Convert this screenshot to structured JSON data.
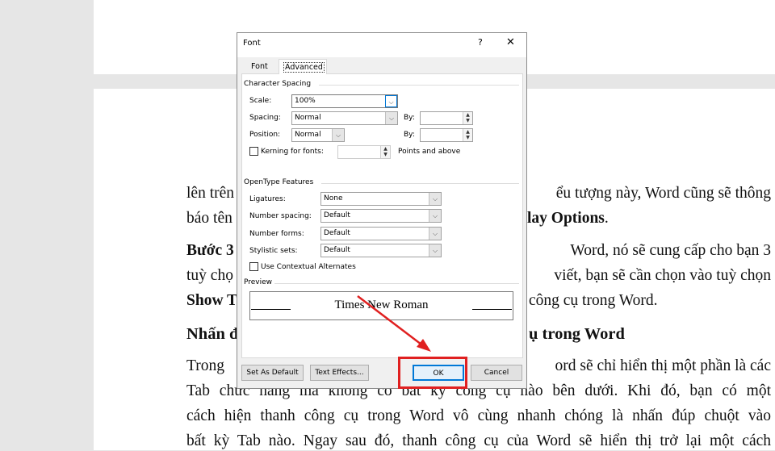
{
  "document": {
    "lines": [
      {
        "left": "lên trên",
        "right": "ểu tượng này, Word cũng sẽ thông"
      },
      {
        "left": "báo tên",
        "right_bold": "lay Options",
        "right": "."
      },
      {
        "left_bold": "Bước 3",
        "right": "Word, nó sẽ cung cấp cho bạn 3"
      },
      {
        "left": "tuỳ chọ",
        "right": "viết, bạn sẽ cần chọn vào tuỳ chọn"
      },
      {
        "left_bold": "Show T",
        "right": "công cụ trong Word."
      },
      {
        "left_bold": "Nhấn đ",
        "right_bold": "ụ trong Word"
      },
      {
        "left": "Trong",
        "right": "ord sẽ chỉ hiển thị một phần là các"
      },
      {
        "full": "Tab chức năng mà không có bất kỳ công cụ nào bên dưới. Khi đó, bạn có một"
      },
      {
        "full": "cách hiện thanh công cụ trong Word vô cùng nhanh chóng là nhấn đúp chuột vào"
      },
      {
        "full": "bất kỳ Tab nào. Ngay sau đó, thanh công cụ của Word sẽ hiển thị trở lại một cách"
      }
    ]
  },
  "dialog": {
    "title": "Font",
    "help": "?",
    "close": "✕",
    "tabs": [
      "Font",
      "Advanced"
    ],
    "character_spacing": {
      "label": "Character Spacing",
      "scale_label": "Scale:",
      "scale": "100%",
      "spacing_label": "Spacing:",
      "spacing": "Normal",
      "position_label": "Position:",
      "position": "Normal",
      "by_label": "By:",
      "by_value": "",
      "by2_value": "",
      "kerning_label": "Kerning for fonts:",
      "kerning_value": "",
      "points_label": "Points and above"
    },
    "opentype": {
      "label": "OpenType Features",
      "ligatures_label": "Ligatures:",
      "ligatures": "None",
      "number_spacing_label": "Number spacing:",
      "number_spacing": "Default",
      "number_forms_label": "Number forms:",
      "number_forms": "Default",
      "stylistic_sets_label": "Stylistic sets:",
      "stylistic_sets": "Default",
      "contextual_label": "Use Contextual Alternates"
    },
    "preview": {
      "label": "Preview",
      "text": "Times New Roman"
    },
    "buttons": {
      "set_default": "Set As Default",
      "text_effects": "Text Effects...",
      "ok": "OK",
      "cancel": "Cancel"
    }
  },
  "colors": {
    "annotation": "#e02020",
    "ok_border": "#0078d7"
  }
}
